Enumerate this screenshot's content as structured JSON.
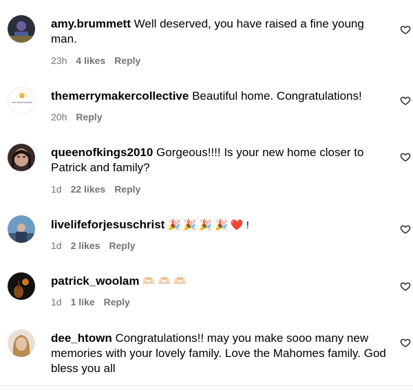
{
  "comments": [
    {
      "username": "amy.brummett",
      "text": " Well deserved, you have raised a fine young man.",
      "time": "23h",
      "likes": "4 likes",
      "reply": "Reply"
    },
    {
      "username": "themerrymakercollective",
      "text": " Beautiful home. Congratulations!",
      "time": "20h",
      "likes": "",
      "reply": "Reply"
    },
    {
      "username": "queenofkings2010",
      "text": " Gorgeous!!!! Is your new home closer to Patrick and family?",
      "time": "1d",
      "likes": "22 likes",
      "reply": "Reply"
    },
    {
      "username": "livelifeforjesuschrist",
      "text": " 🎉 🎉 🎉 🎉 ❤️ !",
      "time": "1d",
      "likes": "2 likes",
      "reply": "Reply"
    },
    {
      "username": "patrick_woolam",
      "text": " 🫶🏻 🫶🏻 🫶🏻",
      "time": "1d",
      "likes": "1 like",
      "reply": "Reply"
    },
    {
      "username": "dee_htown",
      "text": " Congratulations!! may you make sooo many new memories with your lovely family. Love the Mahomes family. God bless you all",
      "time": "",
      "likes": "",
      "reply": ""
    }
  ],
  "logo_text": "THE MERRYMAKER",
  "colors": {
    "meta": "#737373",
    "text": "#000000"
  },
  "icons": {
    "like": "heart-outline-icon"
  }
}
